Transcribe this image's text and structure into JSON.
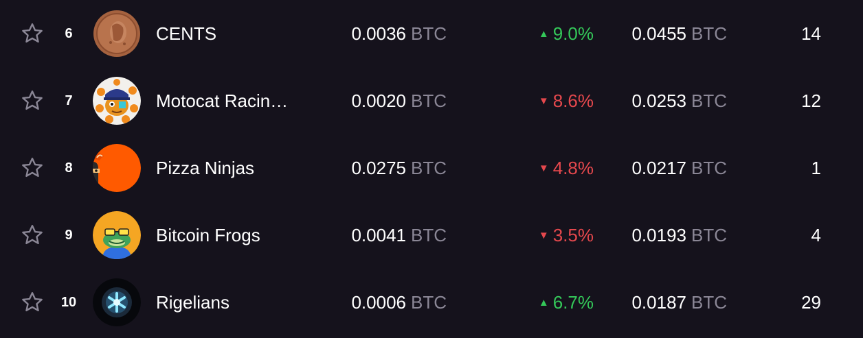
{
  "unit_label": "BTC",
  "colors": {
    "background": "#15121c",
    "positive": "#34c759",
    "negative": "#e5484d",
    "muted": "#8b8796"
  },
  "rows": [
    {
      "rank": "6",
      "name": "CENTS",
      "avatar": "penny-coin-avatar",
      "floor": "0.0036",
      "change": "9.0%",
      "direction": "up",
      "volume": "0.0455",
      "sales": "14"
    },
    {
      "rank": "7",
      "name": "Motocat Racin…",
      "avatar": "motocat-avatar",
      "floor": "0.0020",
      "change": "8.6%",
      "direction": "down",
      "volume": "0.0253",
      "sales": "12"
    },
    {
      "rank": "8",
      "name": "Pizza Ninjas",
      "avatar": "pizza-ninja-avatar",
      "floor": "0.0275",
      "change": "4.8%",
      "direction": "down",
      "volume": "0.0217",
      "sales": "1"
    },
    {
      "rank": "9",
      "name": "Bitcoin Frogs",
      "avatar": "bitcoin-frog-avatar",
      "floor": "0.0041",
      "change": "3.5%",
      "direction": "down",
      "volume": "0.0193",
      "sales": "4"
    },
    {
      "rank": "10",
      "name": "Rigelians",
      "avatar": "rigelian-avatar",
      "floor": "0.0006",
      "change": "6.7%",
      "direction": "up",
      "volume": "0.0187",
      "sales": "29"
    }
  ]
}
